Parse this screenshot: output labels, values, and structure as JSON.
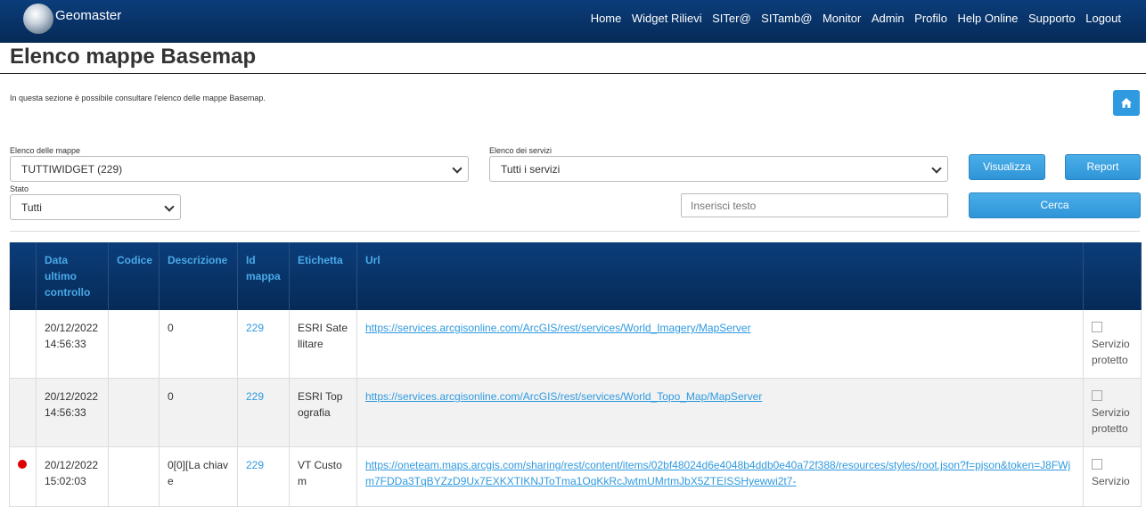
{
  "header": {
    "brand": "Geomaster",
    "nav": [
      "Home",
      "Widget Rilievi",
      "SITer@",
      "SITamb@",
      "Monitor",
      "Admin",
      "Profilo",
      "Help Online",
      "Supporto",
      "Logout"
    ]
  },
  "page": {
    "title": "Elenco mappe Basemap",
    "intro": "In questa sezione è possibile consultare l'elenco delle mappe Basemap."
  },
  "filters": {
    "maps_label": "Elenco delle mappe",
    "maps_value": "TUTTIWIDGET (229)",
    "services_label": "Elenco dei servizi",
    "services_value": "Tutti i servizi",
    "state_label": "Stato",
    "state_value": "Tutti",
    "search_placeholder": "Inserisci testo",
    "view_button": "Visualizza",
    "report_button": "Report",
    "search_button": "Cerca"
  },
  "table": {
    "headers": [
      "",
      "Data ultimo controllo",
      "Codice",
      "Descrizione",
      "Id mappa",
      "Etichetta",
      "Url",
      ""
    ],
    "rows": [
      {
        "status": "",
        "date": "20/12/2022 14:56:33",
        "code": "",
        "description": "0",
        "id": "229",
        "label": "ESRI Satellitare",
        "url": "https://services.arcgisonline.com/ArcGIS/rest/services/World_Imagery/MapServer",
        "image_alt": "Servizio protetto"
      },
      {
        "status": "",
        "date": "20/12/2022 14:56:33",
        "code": "",
        "description": "0",
        "id": "229",
        "label": "ESRI Topografia",
        "url": "https://services.arcgisonline.com/ArcGIS/rest/services/World_Topo_Map/MapServer",
        "image_alt": "Servizio protetto"
      },
      {
        "status": "error",
        "date": "20/12/2022 15:02:03",
        "code": "",
        "description": "0[0][La chiave",
        "id": "229",
        "label": "VT Custom",
        "url": "https://oneteam.maps.arcgis.com/sharing/rest/content/items/02bf48024d6e4048b4ddb0e40a72f388/resources/styles/root.json?f=pjson&token=J8FWjm7FDDa3TqBYZzD9Ux7EXKXTIKNJToTma1OqKkRcJwtmUMrtmJbX5ZTEISSHyewwi2t7-",
        "image_alt": "Servizio"
      }
    ]
  },
  "colors": {
    "header_bg": "#062a57",
    "accent": "#2f9ae0",
    "status_error": "#e00000"
  }
}
